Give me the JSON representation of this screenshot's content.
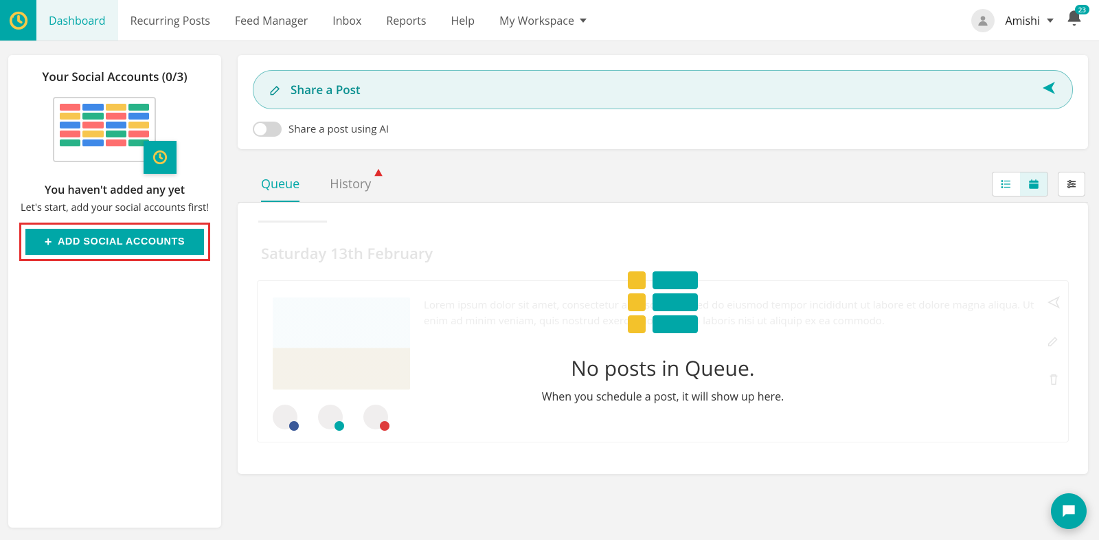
{
  "nav": {
    "items": [
      {
        "label": "Dashboard"
      },
      {
        "label": "Recurring Posts"
      },
      {
        "label": "Feed Manager"
      },
      {
        "label": "Inbox"
      },
      {
        "label": "Reports"
      },
      {
        "label": "Help"
      },
      {
        "label": "My Workspace"
      }
    ]
  },
  "user": {
    "name": "Amishi",
    "notif_count": "23"
  },
  "sidebar": {
    "title": "Your Social Accounts (0/3)",
    "subtitle": "You haven't added any yet",
    "desc": "Let's start, add your social accounts first!",
    "button": "ADD SOCIAL ACCOUNTS"
  },
  "share": {
    "label": "Share a Post",
    "ai_label": "Share a post using AI"
  },
  "tabs": {
    "queue": "Queue",
    "history": "History"
  },
  "ghost": {
    "date": "Saturday 13th February",
    "text": "Lorem ipsum dolor sit amet, consectetur adipiscing elit, sed do eiusmod tempor incididunt ut labore et dolore magna aliqua. Ut enim ad minim veniam, quis nostrud exercitation ullamco laboris nisi ut aliquip ex ea commodo."
  },
  "empty": {
    "title": "No posts in Queue.",
    "sub": "When you schedule a post, it will show up here."
  }
}
